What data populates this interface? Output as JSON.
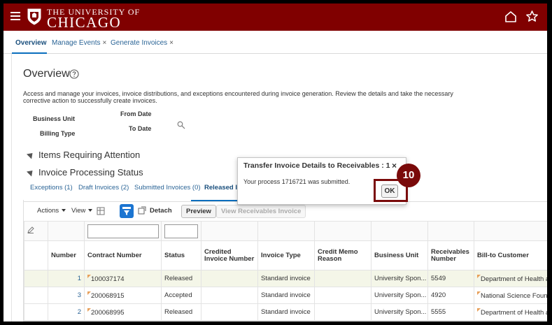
{
  "header": {
    "logo_top": "THE UNIVERSITY OF",
    "logo_bottom": "CHICAGO",
    "brand_color": "#800000",
    "icons": [
      "menu-icon",
      "shield-icon",
      "home-icon",
      "star-icon"
    ]
  },
  "tabs": [
    {
      "label": "Overview",
      "closable": false,
      "active": true
    },
    {
      "label": "Manage Events",
      "closable": true,
      "active": false
    },
    {
      "label": "Generate Invoices",
      "closable": true,
      "active": false
    }
  ],
  "close_glyph": "×",
  "overview": {
    "title": "Overview",
    "description": "Access and manage your invoices, invoice distributions, and exceptions encountered during invoice generation. Review the details and take the necessary corrective action to successfully create invoices.",
    "business_unit_label": "Business Unit",
    "billing_type_label": "Billing Type",
    "from_date_label": "From Date",
    "to_date_label": "To Date"
  },
  "sections": {
    "items_requiring_attention": "Items Requiring Attention",
    "invoice_processing_status": "Invoice Processing Status"
  },
  "subtabs": [
    {
      "label": "Exceptions (1)",
      "active": false
    },
    {
      "label": "Draft Invoices (2)",
      "active": false
    },
    {
      "label": "Submitted Invoices (0)",
      "active": false
    },
    {
      "label": "Released Inv",
      "active": true
    }
  ],
  "toolbar": {
    "actions": "Actions",
    "view": "View",
    "detach": "Detach",
    "preview": "Preview",
    "view_receivables_invoice": "View Receivables Invoice"
  },
  "table": {
    "columns": [
      "Number",
      "Contract Number",
      "Status",
      "Credited Invoice Number",
      "Invoice Type",
      "Credit Memo Reason",
      "Business Unit",
      "Receivables Number",
      "Bill-to Customer"
    ],
    "rows": [
      {
        "number": "1",
        "contract": "100037174",
        "status": "Released",
        "credited": "",
        "type": "Standard invoice",
        "reason": "",
        "bu": "University Spon...",
        "receivables": "5549",
        "customer": "Department of Health a..."
      },
      {
        "number": "3",
        "contract": "200068915",
        "status": "Accepted",
        "credited": "",
        "type": "Standard invoice",
        "reason": "",
        "bu": "University Spon...",
        "receivables": "4920",
        "customer": "National Science Foun..."
      },
      {
        "number": "2",
        "contract": "200068995",
        "status": "Released",
        "credited": "",
        "type": "Standard invoice",
        "reason": "",
        "bu": "University Spon...",
        "receivables": "5555",
        "customer": "Department of Health a..."
      }
    ]
  },
  "dialog": {
    "title": "Transfer Invoice Details to Receivables : 1",
    "message": "Your process 1716721 was submitted.",
    "ok_label": "OK",
    "close_glyph": "×"
  },
  "step_badge": "10",
  "colors": {
    "accent": "#0a6ebd",
    "link": "#2a6496",
    "highlight": "#7a0a0a"
  }
}
